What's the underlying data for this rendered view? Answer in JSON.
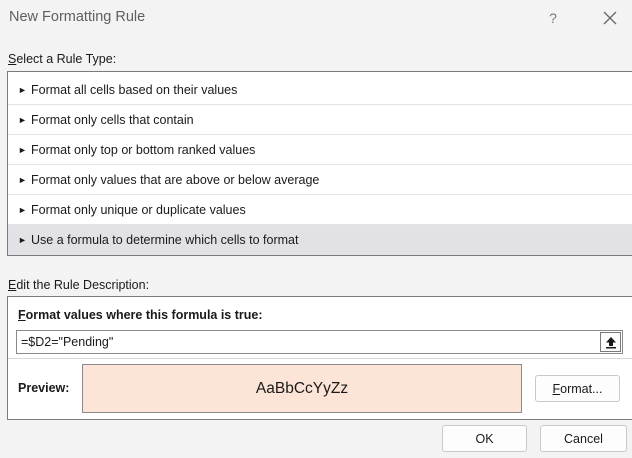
{
  "window": {
    "title": "New Formatting Rule",
    "help_label": "?"
  },
  "rule_type": {
    "label_mnemonic": "S",
    "label_rest": "elect a Rule Type:",
    "arrow": "►",
    "items": [
      {
        "label": "Format all cells based on their values"
      },
      {
        "label": "Format only cells that contain"
      },
      {
        "label": "Format only top or bottom ranked values"
      },
      {
        "label": "Format only values that are above or below average"
      },
      {
        "label": "Format only unique or duplicate values"
      },
      {
        "label": "Use a formula to determine which cells to format",
        "selected": true
      }
    ]
  },
  "description": {
    "label_mnemonic": "E",
    "label_rest": "dit the Rule Description:",
    "formula_label_mnemonic": "F",
    "formula_label_rest": "ormat values where this formula is true:",
    "formula_value": "=$D2=\"Pending\"",
    "preview_label": "Preview:",
    "preview_text": "AaBbCcYyZz",
    "preview_fill": "#fce4d6",
    "format_button_mnemonic": "F",
    "format_button_rest": "ormat..."
  },
  "buttons": {
    "ok": "OK",
    "cancel": "Cancel"
  },
  "colors": {
    "selected_row": "#e1e1e6",
    "dialog_bg": "#f3f3f3"
  }
}
